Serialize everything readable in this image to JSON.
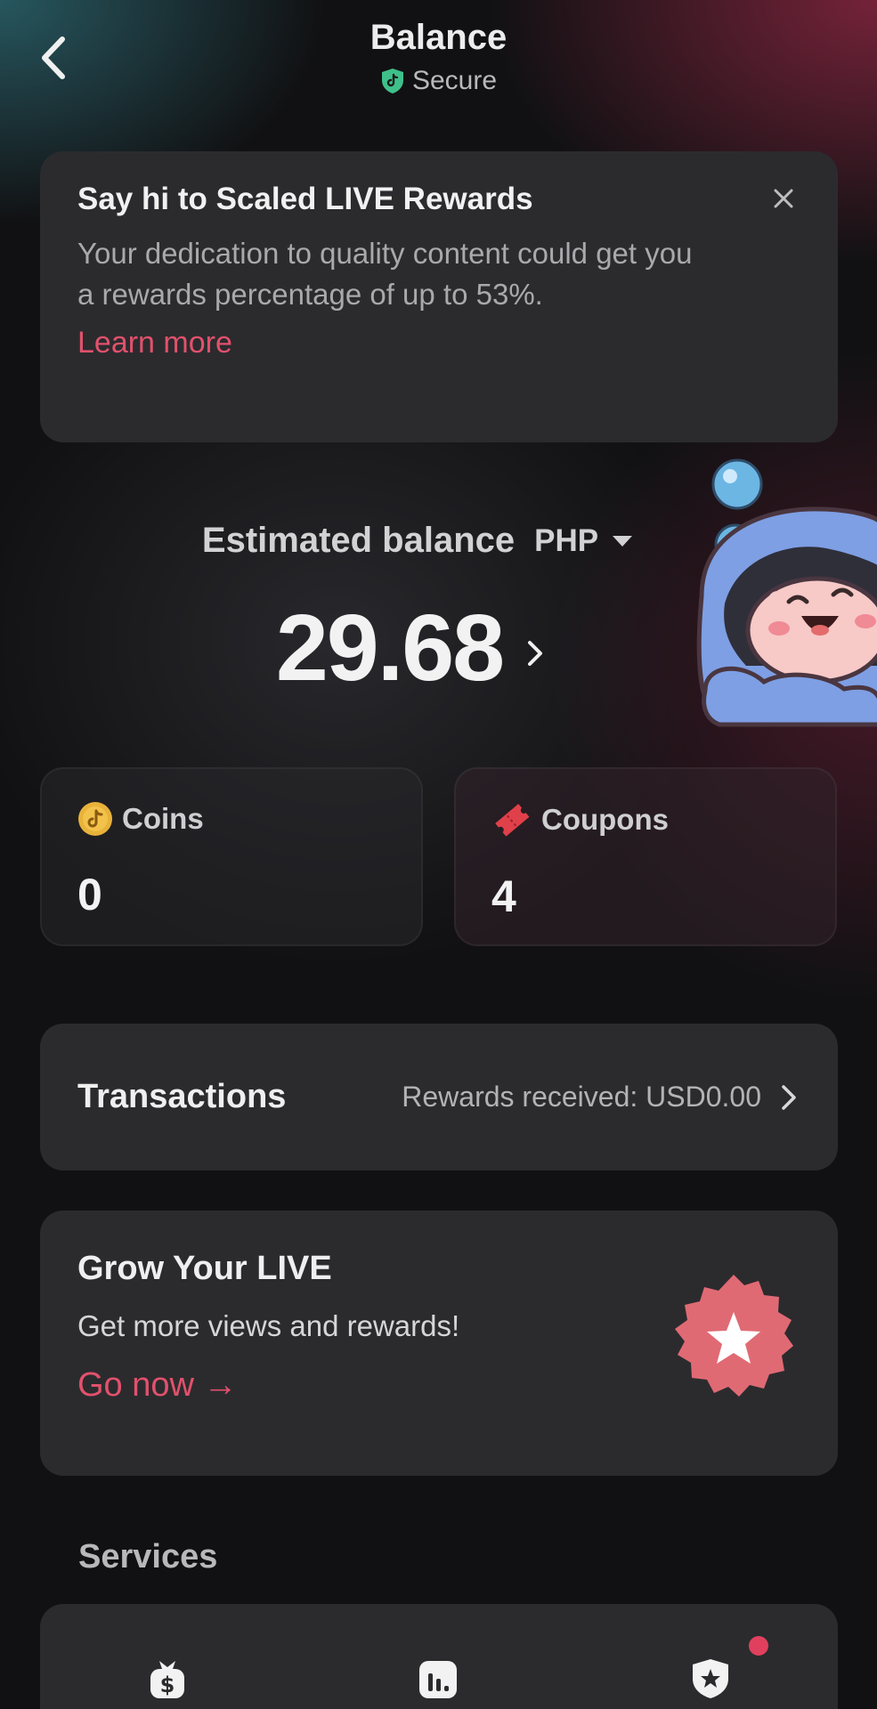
{
  "header": {
    "title": "Balance",
    "secure_label": "Secure",
    "back_icon": "chevron-left-icon",
    "secure_icon": "shield-icon"
  },
  "promo": {
    "title": "Say hi to Scaled LIVE Rewards",
    "body": "Your dedication to quality content could get you a rewards percentage of up to 53%.",
    "link": "Learn more",
    "close_icon": "close-icon"
  },
  "balance": {
    "label": "Estimated balance",
    "currency": "PHP",
    "value": "29.68"
  },
  "stats": {
    "coins": {
      "label": "Coins",
      "value": "0",
      "icon": "coin-icon"
    },
    "coupons": {
      "label": "Coupons",
      "value": "4",
      "icon": "coupon-icon"
    }
  },
  "transactions": {
    "title": "Transactions",
    "info": "Rewards received: USD0.00"
  },
  "grow": {
    "title": "Grow Your LIVE",
    "subtitle": "Get more views and rewards!",
    "link": "Go now →"
  },
  "services": {
    "title": "Services",
    "icons": [
      "dollar-bag-icon",
      "bar-chart-icon",
      "star-shield-icon"
    ]
  },
  "colors": {
    "accent": "#e2516c",
    "card": "#2b2b2e",
    "background": "#111113",
    "coin": "#e8b23a",
    "secure": "#3fc08a"
  }
}
